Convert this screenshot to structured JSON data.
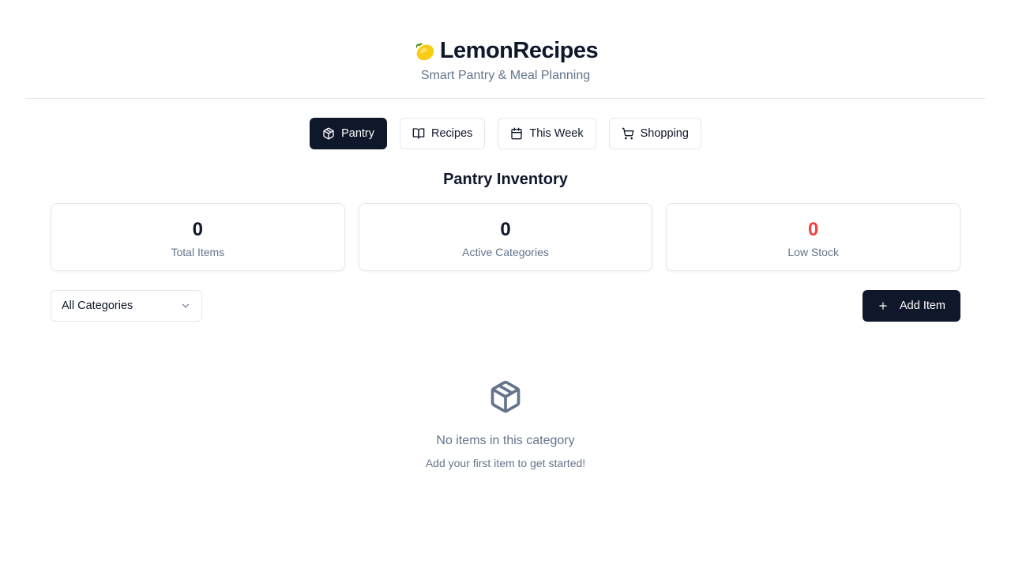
{
  "app": {
    "title": "LemonRecipes",
    "subtitle": "Smart Pantry & Meal Planning",
    "logo_icon": "lemon-icon"
  },
  "tabs": [
    {
      "label": "Pantry",
      "icon": "package-icon",
      "active": true
    },
    {
      "label": "Recipes",
      "icon": "book-open-icon",
      "active": false
    },
    {
      "label": "This Week",
      "icon": "calendar-icon",
      "active": false
    },
    {
      "label": "Shopping",
      "icon": "shopping-cart-icon",
      "active": false
    }
  ],
  "section": {
    "title": "Pantry Inventory"
  },
  "stats": [
    {
      "value": "0",
      "label": "Total Items"
    },
    {
      "value": "0",
      "label": "Active Categories"
    },
    {
      "value": "0",
      "label": "Low Stock"
    }
  ],
  "filter": {
    "selected": "All Categories"
  },
  "actions": {
    "add_label": "Add Item"
  },
  "empty_state": {
    "icon": "package-icon",
    "message": "No items in this category",
    "hint": "Add your first item to get started!"
  },
  "colors": {
    "primary": "#0f172a",
    "muted_text": "#64748b",
    "border": "#e2e8f0",
    "danger": "#ef4444",
    "lemon": "#facc15"
  }
}
